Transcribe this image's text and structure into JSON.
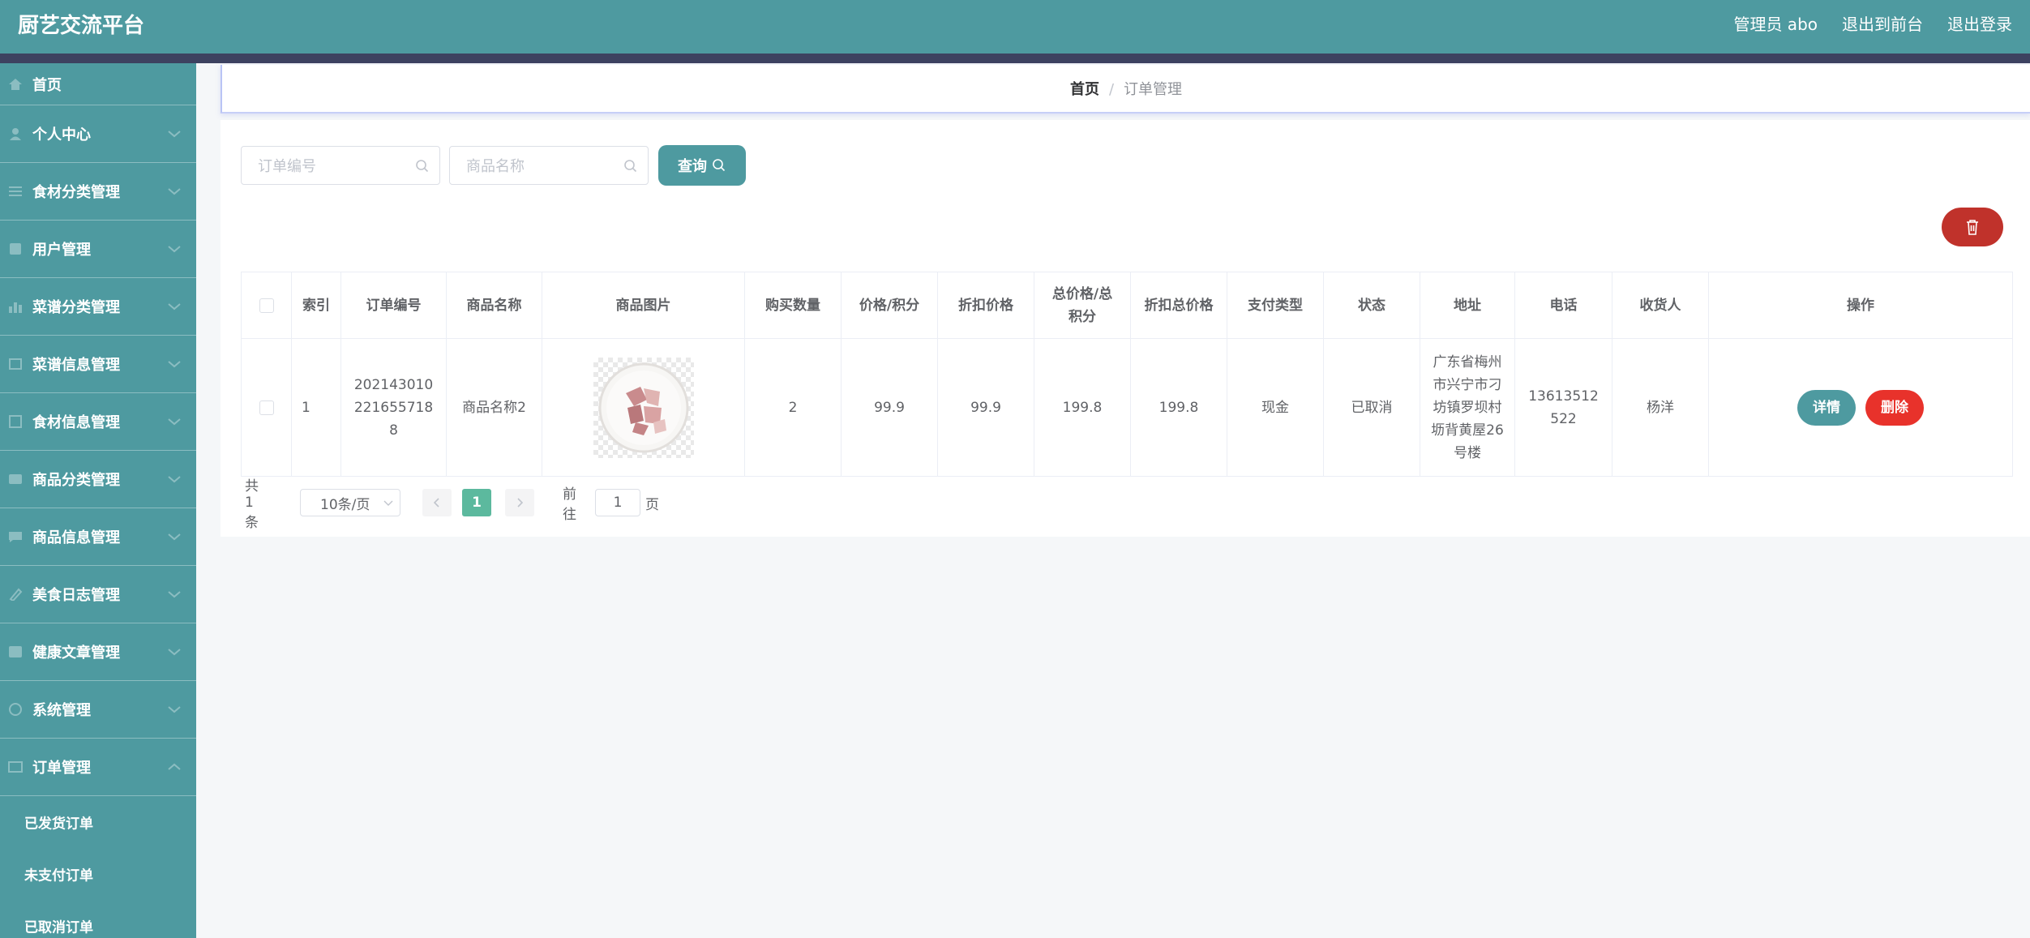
{
  "header": {
    "title": "厨艺交流平台",
    "admin_label": "管理员 abo",
    "to_frontend": "退出到前台",
    "logout": "退出登录"
  },
  "sidebar": {
    "items": [
      {
        "label": "首页",
        "icon": "home-icon"
      },
      {
        "label": "个人中心",
        "icon": "user-icon"
      },
      {
        "label": "食材分类管理",
        "icon": "list-icon"
      },
      {
        "label": "用户管理",
        "icon": "user-manage-icon"
      },
      {
        "label": "菜谱分类管理",
        "icon": "bar-chart-icon"
      },
      {
        "label": "菜谱信息管理",
        "icon": "recipe-icon"
      },
      {
        "label": "食材信息管理",
        "icon": "ingredient-icon"
      },
      {
        "label": "商品分类管理",
        "icon": "goods-category-icon"
      },
      {
        "label": "商品信息管理",
        "icon": "goods-icon"
      },
      {
        "label": "美食日志管理",
        "icon": "diary-icon"
      },
      {
        "label": "健康文章管理",
        "icon": "article-icon"
      },
      {
        "label": "系统管理",
        "icon": "system-icon"
      },
      {
        "label": "订单管理",
        "icon": "order-icon"
      }
    ],
    "sub_items": [
      "已发货订单",
      "未支付订单",
      "已取消订单"
    ]
  },
  "breadcrumb": {
    "home": "首页",
    "separator": "/",
    "current": "订单管理"
  },
  "search": {
    "order_placeholder": "订单编号",
    "goods_placeholder": "商品名称",
    "query_label": "查询"
  },
  "table": {
    "headers": [
      "索引",
      "订单编号",
      "商品名称",
      "商品图片",
      "购买数量",
      "价格/积分",
      "折扣价格",
      "总价格/总积分",
      "折扣总价格",
      "支付类型",
      "状态",
      "地址",
      "电话",
      "收货人",
      "操作"
    ],
    "rows": [
      {
        "index": "1",
        "order_no": "2021430102216557188",
        "goods_name": "商品名称2",
        "quantity": "2",
        "price": "99.9",
        "discount_price": "99.9",
        "total": "199.8",
        "discount_total": "199.8",
        "pay_type": "现金",
        "status": "已取消",
        "address": "广东省梅州市兴宁市刁坊镇罗坝村坜背黄屋26号楼",
        "phone": "13613512522",
        "receiver": "杨洋"
      }
    ],
    "detail_label": "详情",
    "delete_label": "删除"
  },
  "pagination": {
    "total_text": "共 1 条",
    "page_size": "10条/页",
    "current_page": "1",
    "goto_prefix": "前往",
    "goto_value": "1",
    "goto_suffix": "页"
  },
  "colors": {
    "primary": "#4e9aa0",
    "danger": "#e8322b",
    "header_stripe": "#3d4260"
  }
}
